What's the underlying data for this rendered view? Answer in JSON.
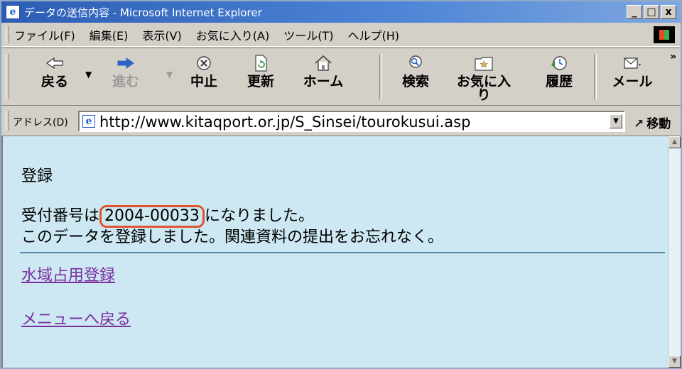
{
  "window": {
    "title": "データの送信内容 - Microsoft Internet Explorer",
    "minimize": "_",
    "maximize": "□",
    "close": "x"
  },
  "menu": [
    "ファイル(F)",
    "編集(E)",
    "表示(V)",
    "お気に入り(A)",
    "ツール(T)",
    "ヘルプ(H)"
  ],
  "toolbar": {
    "back": "戻る",
    "forward": "進む",
    "stop": "中止",
    "refresh": "更新",
    "home": "ホーム",
    "search": "検索",
    "favorites": "お気に入",
    "favorites_line2": "り",
    "history": "履歴",
    "mail": "メール",
    "more": "»"
  },
  "address": {
    "label": "アドレス(D)",
    "url": "http://www.kitaqport.or.jp/S_Sinsei/tourokusui.asp",
    "go": "移動"
  },
  "content": {
    "heading": "登録",
    "receipt_prefix": "受付番号は",
    "receipt_number": "2004-00033",
    "receipt_suffix": "になりました。",
    "message": "このデータを登録しました。関連資料の提出をお忘れなく。",
    "link_register": "水域占用登録",
    "link_menu": "メニューへ戻る"
  }
}
